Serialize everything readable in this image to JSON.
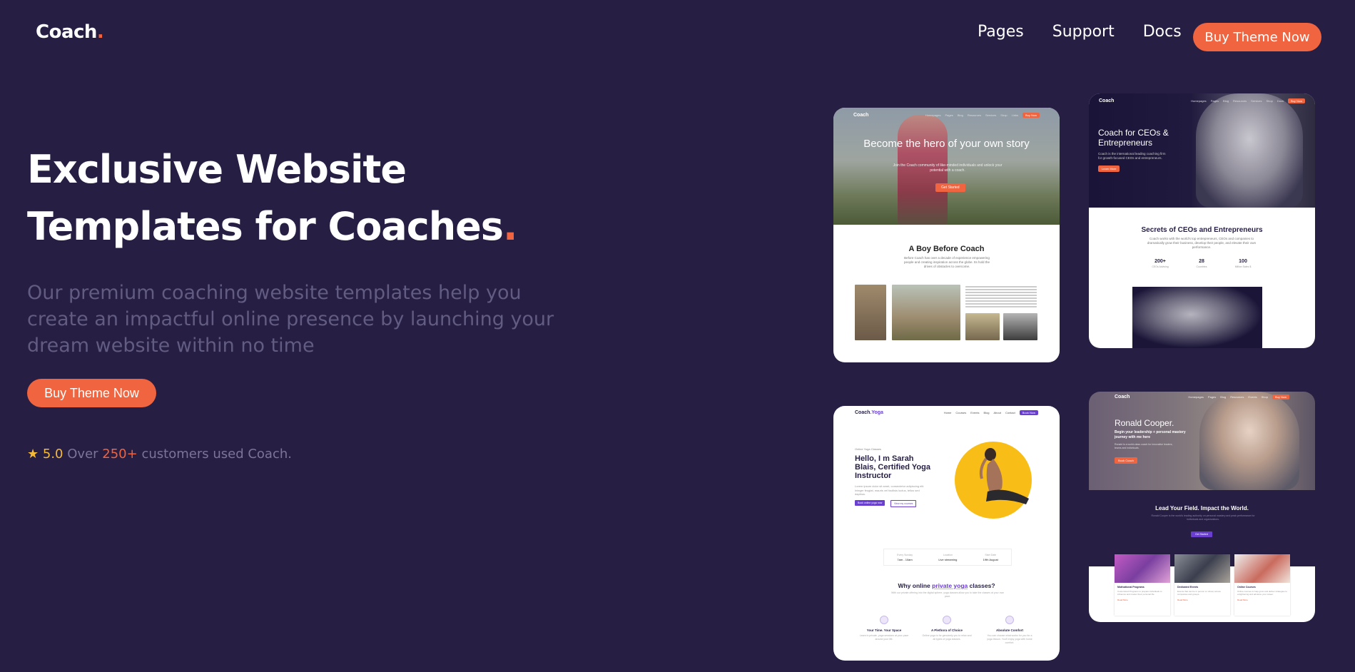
{
  "brand": {
    "name": "Coach",
    "dot": "."
  },
  "nav": {
    "items": [
      "Pages",
      "Support",
      "Docs"
    ],
    "cta": "Buy Theme Now"
  },
  "hero": {
    "title_line1": "Exclusive Website",
    "title_line2": "Templates for Coaches",
    "title_dot": ".",
    "subtitle": "Our premium coaching website templates help you create an impactful online presence by launching your dream website within no time",
    "cta": "Buy Theme Now",
    "rating": {
      "star": "★",
      "score": "5.0",
      "prefix": "Over",
      "count": "250+",
      "suffix": "customers used Coach."
    }
  },
  "previews": {
    "card1": {
      "logo": "Coach",
      "nav": [
        "Homepages",
        "Pages",
        "Blog",
        "Resources",
        "Services",
        "Shop",
        "Links"
      ],
      "nav_btn": "Buy Now",
      "banner_title": "Become the hero of your own story",
      "banner_text": "Join the Coach community of like-minded individuals and unlock your potential with a coach.",
      "banner_btn": "Get Started",
      "section_title": "A Boy Before Coach",
      "section_text": "Before Coach has over a decade of experience empowering people and creating inspiration across the globe. Its hold the drives of obstacles to overcome."
    },
    "card2": {
      "logo": "Coach",
      "nav": [
        "Homepages",
        "Pages",
        "Blog",
        "Resources",
        "Services",
        "Shop",
        "Docs"
      ],
      "nav_btn": "Buy Now",
      "banner_title": "Coach for CEOs & Entrepreneurs",
      "banner_text": "Coach is the international leading coaching firm for growth-focused CEOs and entrepreneurs.",
      "banner_btn": "Learn More",
      "section_title": "Secrets of CEOs and Entrepreneurs",
      "section_text": "Coach works with the world's top entrepreneurs, CEOs and companies to dramatically grow their business, develop their people, and elevate their own performance.",
      "stats": [
        {
          "value": "200+",
          "label": "CEOs Advising"
        },
        {
          "value": "28",
          "label": "Countries"
        },
        {
          "value": "100",
          "label": "Million Sales $"
        }
      ]
    },
    "card3": {
      "logo": "Coach",
      "logo_suffix": ".Yoga",
      "nav": [
        "Home",
        "Courses",
        "Events",
        "Blog",
        "About",
        "Contact"
      ],
      "nav_btn": "Book Now",
      "kicker": "Online Yoga Classes",
      "title": "Hello, I m Sarah Blais, Certified Yoga Instructor",
      "text": "Lorem ipsum dolor sit amet, consectetur adipiscing elit. Integer feugiat, mauris vel facilisis luctus, tellus sed dapibus.",
      "btn1": "Book online yoga now",
      "btn2": "View my courses",
      "info": [
        {
          "label": "Every Sunday",
          "value": "7am - 10am"
        },
        {
          "label": "Location",
          "value": "Live streaming"
        },
        {
          "label": "Start Date",
          "value": "19th August"
        }
      ],
      "section_title_pre": "Why online",
      "section_title_hl": "private yoga",
      "section_title_post": "classes?",
      "section_text": "With our private offering into the digital sphere, yoga classes allow you to take the classes at your own pace.",
      "features": [
        {
          "title": "Your Time. Your Space",
          "text": "Learn in private, yoga sessions at your pace around your life."
        },
        {
          "title": "A Plethora of Choice",
          "text": "Online yoga is for genuinely you to relax and all types of yoga classes."
        },
        {
          "title": "Absolute Comfort",
          "text": "You can choose what works for you for a yoga lesson. You'll enjoy yoga with home comfort."
        }
      ]
    },
    "card4": {
      "logo": "Coach",
      "nav": [
        "Homepages",
        "Pages",
        "Blog",
        "Resources",
        "Events",
        "Shop"
      ],
      "nav_btn": "Buy Now",
      "banner_title": "Ronald Cooper.",
      "banner_sub": "Begin your leadership + personal mastery journey with me here",
      "banner_text": "Ronald is a world-class coach for innovative leaders, teams and individuals.",
      "banner_btn": "Book Coach",
      "section_title": "Lead Your Field. Impact the World.",
      "section_text": "Ronald Cooper is the world's leading authority on personal mastery and peak performance for individuals and organizations.",
      "section_btn": "Get Started",
      "tiles": [
        {
          "title": "Motivational Programs",
          "text": "Customized Programs to prepare individuals to influence and master their personal life.",
          "link": "Read More"
        },
        {
          "title": "Dedicated Events",
          "text": "Events that can be in person or virtual, across companies and groups.",
          "link": "Read More"
        },
        {
          "title": "Online Courses",
          "text": "Online courses to help grow and deliver strategies to enlightening and advance your career.",
          "link": "Read More"
        }
      ]
    }
  },
  "colors": {
    "background": "#261e43",
    "accent": "#f0643f",
    "muted_text": "#625c82",
    "star": "#f5b93a"
  }
}
